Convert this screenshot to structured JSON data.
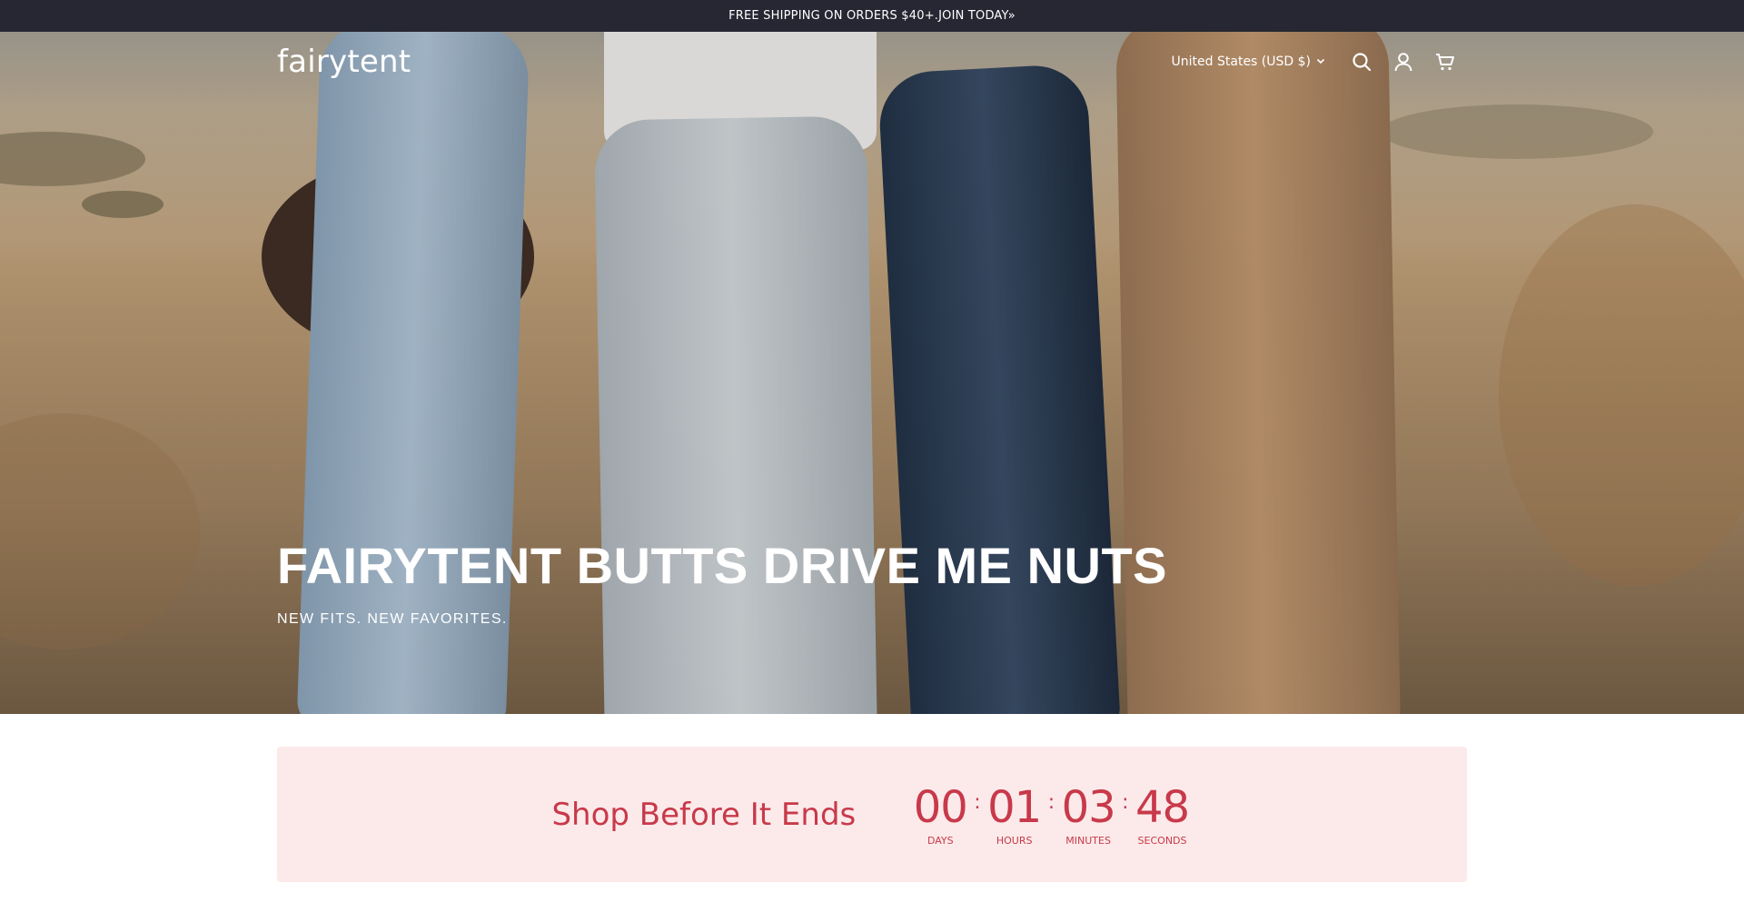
{
  "announcement": {
    "text": "FREE SHIPPING ON ORDERS $40+.JOIN TODAY»"
  },
  "header": {
    "logo": "fairytent",
    "currency": "United States (USD $)",
    "icons": [
      "search-icon",
      "account-icon",
      "cart-icon"
    ]
  },
  "hero": {
    "title": "FAIRYTENT BUTTS DRIVE ME NUTS",
    "subtitle": "NEW FITS. NEW FAVORITES."
  },
  "countdown": {
    "heading": "Shop Before It Ends",
    "days": "00",
    "days_label": "DAYS",
    "hours": "01",
    "hours_label": "HOURS",
    "minutes": "03",
    "minutes_label": "MINUTES",
    "seconds": "48",
    "seconds_label": "SECONDS",
    "color": "#c8394a",
    "background": "#fceaea"
  },
  "colors": {
    "announcement_bar": "#262733",
    "accent": "#c8394a"
  }
}
